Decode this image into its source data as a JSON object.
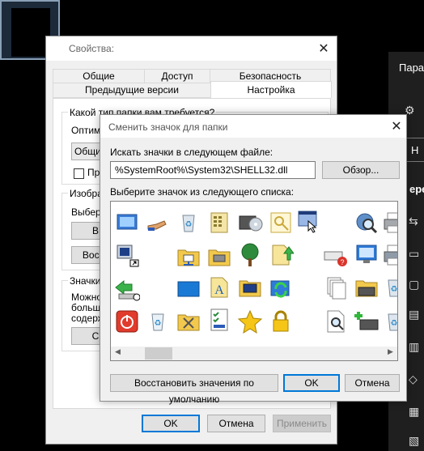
{
  "desktop": {
    "side_title": "Пара",
    "side_letter": "Н",
    "side_cut_text": "ере"
  },
  "properties_dialog": {
    "title": "Свойства:",
    "tabs_row1": [
      "Общие",
      "Доступ",
      "Безопасность"
    ],
    "tabs_row2": [
      "Предыдущие версии",
      "Настройка"
    ],
    "active_tab": "Настройка",
    "group1_label": "Какой тип папки вам требуется?",
    "optimize_label": "Оптими",
    "optimize_value": "Общие",
    "apply_subfolders_label": "При",
    "group2_label": "Изобра",
    "choose_label": "Выбери",
    "choose_button": "В",
    "restore_button": "Восст",
    "group3_label": "Значки",
    "group3_text": [
      "Можно",
      "больше",
      "содерж"
    ],
    "change_icon_button": "С",
    "ok": "OK",
    "cancel": "Отмена",
    "apply": "Применить"
  },
  "change_icon_dialog": {
    "title": "Сменить значок для папки",
    "search_label": "Искать значки в следующем файле:",
    "path_value": "%SystemRoot%\\System32\\SHELL32.dll",
    "browse_button": "Обзор...",
    "list_label": "Выберите значок из следующего списка:",
    "restore_defaults_button": "Восстановить значения по умолчанию",
    "ok": "OK",
    "cancel": "Отмена",
    "icons": [
      [
        "window-screen",
        "hand-share",
        "recycle-bin",
        "keypad-document",
        "dvd-drive",
        "key-window",
        "window-cursor",
        "",
        "globe-magnifier",
        "printer"
      ],
      [
        "computer-shortcut",
        "folder-network",
        "drive-open",
        "tree",
        "document-upload",
        "",
        "",
        "",
        "network-error-printer",
        "network-desktop"
      ],
      [
        "network-arrow",
        "",
        "blue-window",
        "font-a",
        "computer-monitor",
        "sync-arrows",
        "",
        "",
        "documents-stack",
        "printer-folder"
      ],
      [
        "power-button",
        "recycle-full",
        "folder-tools",
        "checklist",
        "star",
        "padlock",
        "",
        "",
        "document-search",
        "printer-add"
      ]
    ]
  }
}
